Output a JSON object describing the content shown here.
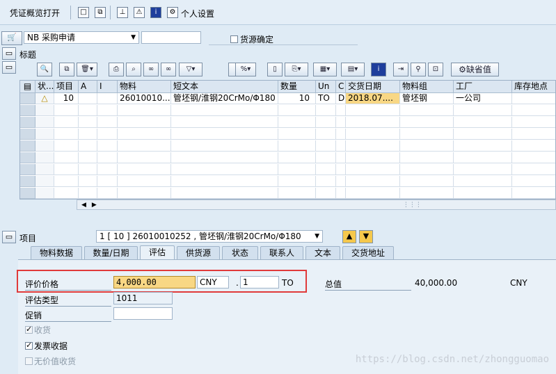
{
  "toolbar": {
    "toggle_label": "凭证概览打开",
    "personal_settings": "个人设置"
  },
  "header": {
    "doc_type_value": "NB 采购申请",
    "doc_number_value": "",
    "source_determination_label": "货源确定",
    "title_label": "标题"
  },
  "grid": {
    "columns": [
      "状...",
      "项目",
      "A",
      "I",
      "物料",
      "短文本",
      "数量",
      "Un",
      "C",
      "交货日期",
      "物料组",
      "工厂",
      "库存地点"
    ],
    "row": {
      "status": "△",
      "item": "10",
      "material": "26010010...",
      "short_text": "管坯钢/淮钢20CrMo/Φ180",
      "quantity": "10",
      "unit": "TO",
      "c": "D",
      "delivery_date": "2018.07....",
      "material_group": "管坯钢",
      "plant": "一公司"
    },
    "default_values_button": "缺省值"
  },
  "item_section": {
    "label": "项目",
    "selected": "1 [ 10 ] 26010010252 , 管坯钢/淮钢20CrMo/Φ180"
  },
  "tabs": [
    {
      "label": "物料数据"
    },
    {
      "label": "数量/日期"
    },
    {
      "label": "评估"
    },
    {
      "label": "供货源"
    },
    {
      "label": "状态"
    },
    {
      "label": "联系人"
    },
    {
      "label": "文本"
    },
    {
      "label": "交货地址"
    }
  ],
  "valuation": {
    "price_label": "评价价格",
    "price_value": "4,000.00",
    "currency": "CNY",
    "price_unit": "1",
    "unit": "TO",
    "total_label": "总值",
    "total_value": "40,000.00",
    "total_currency": "CNY",
    "valuation_type_label": "评估类型",
    "valuation_type_value": "1011",
    "promotion_label": "促销",
    "promotion_value": "",
    "gr_label": "收货",
    "invoice_receipt_label": "发票收据",
    "gr_nonvaluated_label": "无价值收货"
  },
  "watermark": "https://blog.csdn.net/zhongguomao"
}
